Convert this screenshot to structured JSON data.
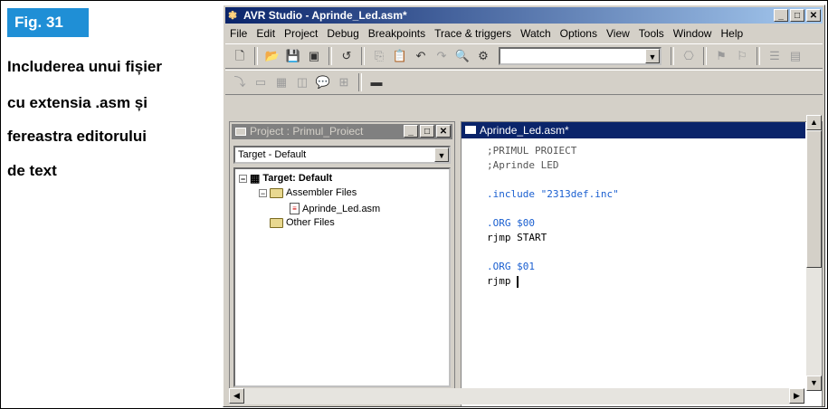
{
  "caption": {
    "figure_label": "Fig. 31",
    "lines": [
      "Includerea unui fișier",
      "cu extensia .asm și",
      "fereastra editorului",
      "de text"
    ]
  },
  "window": {
    "title": "AVR Studio - Aprinde_Led.asm*",
    "menu": [
      "File",
      "Edit",
      "Project",
      "Debug",
      "Breakpoints",
      "Trace & triggers",
      "Watch",
      "Options",
      "View",
      "Tools",
      "Window",
      "Help"
    ]
  },
  "project_pane": {
    "title": "Project : Primul_Proiect",
    "target_select": "Target - Default",
    "tree": {
      "root": "Target: Default",
      "assembler_files": "Assembler Files",
      "file": "Aprinde_Led.asm",
      "other_files": "Other Files"
    }
  },
  "editor": {
    "title": "Aprinde_Led.asm*",
    "lines": [
      ";PRIMUL PROIECT",
      ";Aprinde LED",
      "",
      ".include \"2313def.inc\"",
      "",
      ".ORG $00",
      "rjmp START",
      "",
      ".ORG $01",
      "rjmp "
    ]
  },
  "colors": {
    "fig_badge": "#1f8fd6",
    "active_title": "#0a246a",
    "inactive_title": "#808080",
    "directive": "#1a5fd0"
  }
}
